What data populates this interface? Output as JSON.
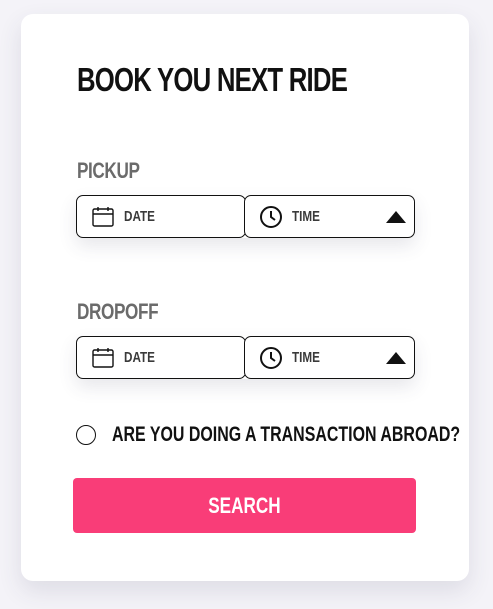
{
  "form": {
    "title": "BOOK YOU NEXT RIDE",
    "pickup": {
      "label": "PICKUP",
      "date_label": "DATE",
      "time_label": "TIME",
      "date_icon": "calendar-icon",
      "time_icon": "clock-icon"
    },
    "dropoff": {
      "label": "DROPOFF",
      "date_label": "DATE",
      "time_label": "TIME",
      "date_icon": "calendar-icon",
      "time_icon": "clock-icon"
    },
    "abroad_question": "ARE YOU DOING A TRANSACTION ABROAD?",
    "abroad_checked": false,
    "search_label": "SEARCH"
  },
  "colors": {
    "accent": "#f93d78",
    "text": "#111111",
    "muted": "#6b6b6b",
    "card": "#ffffff",
    "background": "#f4f3f8"
  }
}
